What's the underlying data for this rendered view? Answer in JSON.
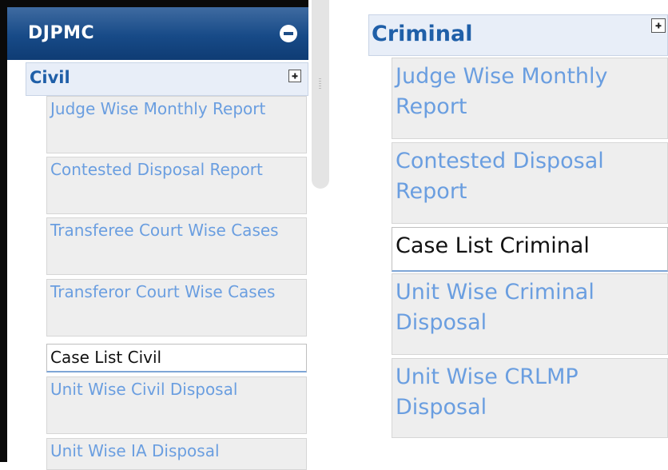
{
  "left_panel": {
    "title": "DJPMC",
    "group": {
      "label": "Civil"
    },
    "items": [
      {
        "label": "Judge Wise Monthly Report",
        "active": false
      },
      {
        "label": "Contested Disposal Report",
        "active": false
      },
      {
        "label": "Transferee Court Wise Cases",
        "active": false
      },
      {
        "label": "Transferor Court Wise Cases",
        "active": false
      },
      {
        "label": "Case List Civil",
        "active": true
      },
      {
        "label": "Unit Wise Civil Disposal",
        "active": false
      },
      {
        "label": "Unit Wise IA Disposal",
        "active": false
      }
    ]
  },
  "right_panel": {
    "group": {
      "label": "Criminal"
    },
    "items": [
      {
        "label": "Judge Wise Monthly Report",
        "active": false
      },
      {
        "label": "Contested Disposal Report",
        "active": false
      },
      {
        "label": "Case List Criminal",
        "active": true
      },
      {
        "label": "Unit Wise Criminal Disposal",
        "active": false
      },
      {
        "label": "Unit Wise CRLMP Disposal",
        "active": false
      }
    ]
  },
  "colors": {
    "header_bg": "#174a87",
    "link_text": "#6a9ee0",
    "group_text": "#1f5fa8",
    "active_text": "#111111",
    "item_bg": "#eeeeee"
  },
  "icons": {
    "header_toggle": "collapse-minus-icon",
    "group_toggle": "expand-plus-icon"
  }
}
